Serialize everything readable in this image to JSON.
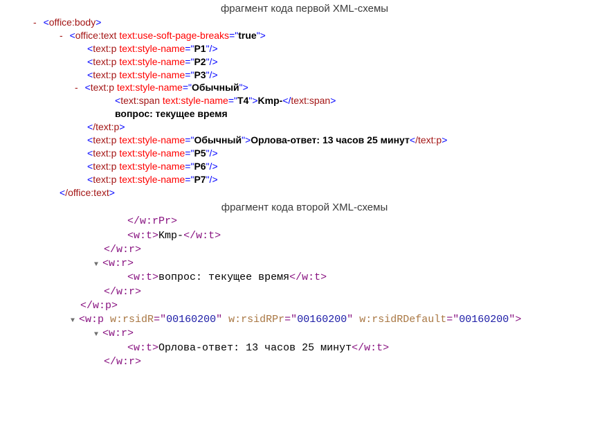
{
  "caption1": "фрагмент кода первой XML-схемы",
  "caption2": "фрагмент кода второй XML-схемы",
  "xml1": {
    "dash": "-",
    "lt": "<",
    "gt": ">",
    "sl": "/",
    "eq": "=",
    "q": "\"",
    "office_body": "office:body",
    "office_text": "office:text",
    "attr_softbreaks": "text:use-soft-page-breaks",
    "true": "true",
    "text_p": "text:p",
    "attr_stylename": "text:style-name",
    "P1": "P1",
    "P2": "P2",
    "P3": "P3",
    "Obychny": "Обычный",
    "text_span": "text:span",
    "T4": "T4",
    "Kmp": "Kmp-",
    "vopros_line": "вопрос: текущее время",
    "close_textp": "/text:p",
    "orlovatext": "Орлова-ответ: 13 часов 25 минут",
    "P5": "P5",
    "P6": "P6",
    "P7": "P7",
    "close_officetext": "/office:text"
  },
  "xml2": {
    "lt": "<",
    "gt": ">",
    "sl": "/",
    "eq": "=",
    "q": "\"",
    "w_rPr_close": "/w:rPr",
    "w_t": "w:t",
    "w_t_close": "/w:t",
    "w_r": "w:r",
    "w_r_close": "/w:r",
    "w_p": "w:p",
    "w_p_close": "/w:p",
    "Kmp": "Kmp-",
    "vopros": "вопрос: текущее время",
    "rsidR": "w:rsidR",
    "rsidRPr": "w:rsidRPr",
    "rsidRDefault": "w:rsidRDefault",
    "rsidVal": "00160200",
    "orlovatext": "Орлова-ответ: 13 часов 25 минут"
  }
}
